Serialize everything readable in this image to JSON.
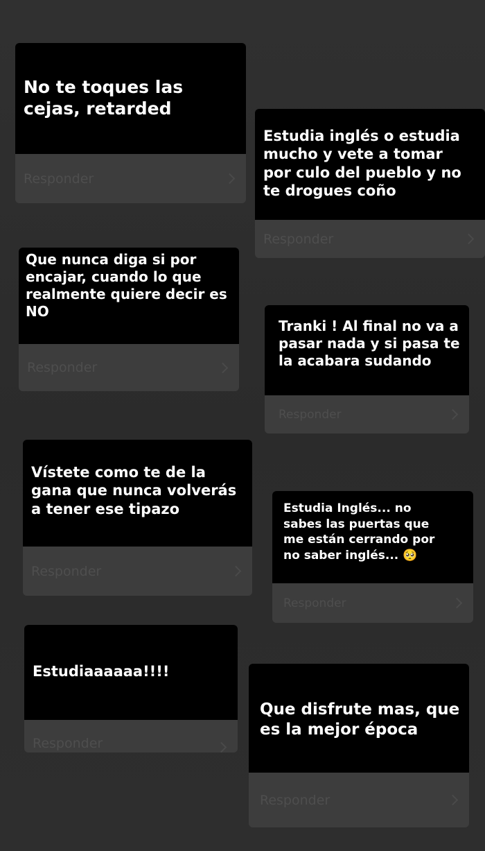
{
  "reply_label": "Responder",
  "chevron_icon": "chevron-right-icon",
  "colors": {
    "background": "#2d2d2d",
    "question_bg": "#000000",
    "question_text": "#ffffff",
    "reply_bg": "#3d3d3d",
    "reply_text": "#4e4e4e"
  },
  "cards": [
    {
      "text": "No te toques las\ncejas, retarded"
    },
    {
      "text": "Estudia inglés o estudia\nmucho y vete a tomar\npor culo del pueblo y no\nte drogues coño"
    },
    {
      "text": "Que nunca diga si por\nencajar, cuando lo que\nrealmente quiere decir es\nNO"
    },
    {
      "text": "Tranki ! Al final no va a\npasar nada y si pasa te\nla acabara sudando"
    },
    {
      "text": "Vístete como te de la\ngana que nunca volverás\na tener ese tipazo"
    },
    {
      "text": "Estudia Inglés... no\nsabes las puertas que\nme están cerrando por\nno saber inglés... 🥺"
    },
    {
      "text": "Estudiaaaaaa!!!!"
    },
    {
      "text": "Que disfrute mas, que\nes la mejor época"
    }
  ]
}
